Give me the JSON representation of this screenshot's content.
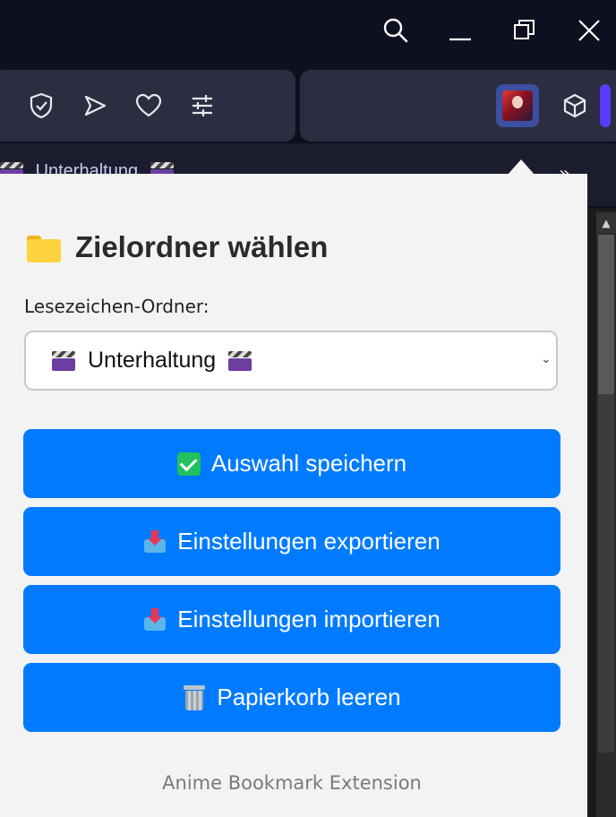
{
  "browser": {
    "window_controls": [
      "search-icon",
      "minimize-icon",
      "restore-icon",
      "close-icon"
    ],
    "toolbar_icons": [
      "shield-check-icon",
      "send-icon",
      "heart-icon",
      "sliders-icon",
      "extension-avatar-icon",
      "cube-icon"
    ],
    "bookmark_bar": {
      "item_label": "Unterhaltung",
      "overflow": "»"
    }
  },
  "popup": {
    "title": "Zielordner wählen",
    "folder_label": "Lesezeichen-Ordner:",
    "selected_folder": "Unterhaltung",
    "buttons": {
      "save": "Auswahl speichern",
      "export": "Einstellungen exportieren",
      "import": "Einstellungen importieren",
      "trash": "Papierkorb leeren"
    },
    "footer": "Anime Bookmark Extension"
  },
  "colors": {
    "primary_button": "#007bff",
    "popup_background": "#f3f3f3",
    "browser_chrome": "#0e0f1f",
    "toolbar": "#2b2d40",
    "accent": "#5b3bff"
  }
}
